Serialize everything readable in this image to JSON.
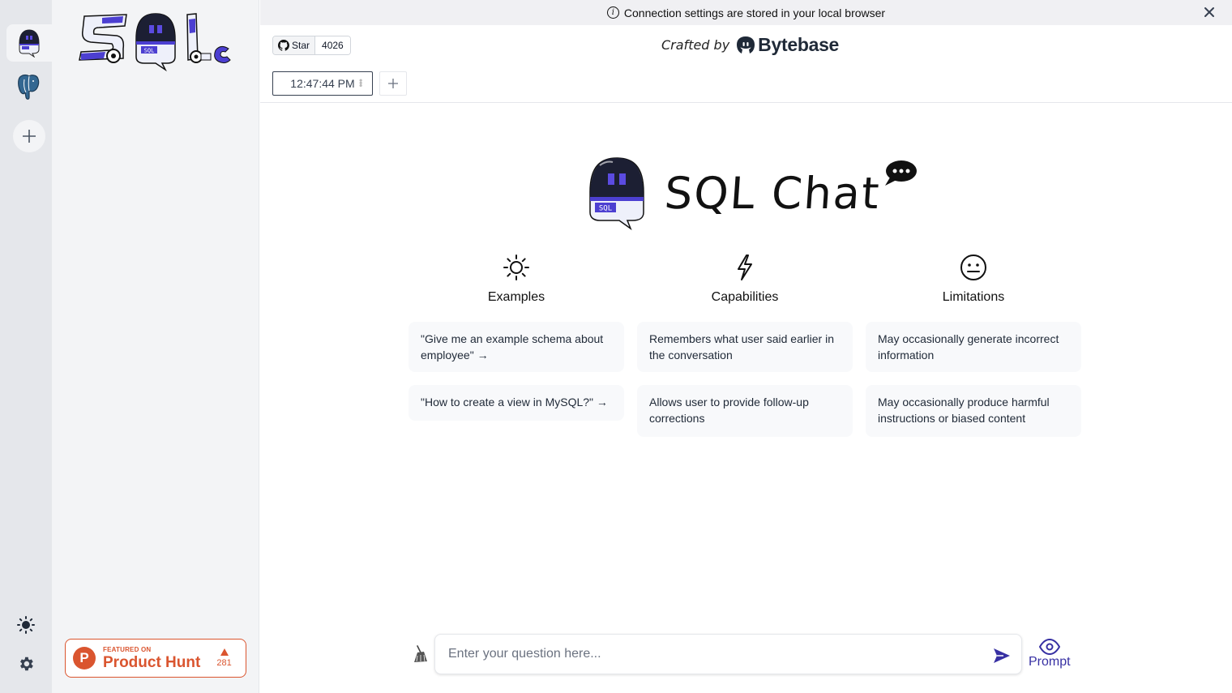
{
  "rail": {
    "items": [
      {
        "name": "sql-chat-connection",
        "active": true
      },
      {
        "name": "postgresql-connection",
        "active": false
      }
    ],
    "add_label": "+",
    "theme_icon": "sun-icon",
    "settings_icon": "gear-icon"
  },
  "sidebar": {
    "logo_text": "SQL Chat logo",
    "product_hunt": {
      "featured_on": "FEATURED ON",
      "name": "Product Hunt",
      "votes": "281",
      "logo_letter": "P"
    }
  },
  "banner": {
    "text": "Connection settings are stored in your local browser",
    "info_icon": "i"
  },
  "header": {
    "github": {
      "star_label": "Star",
      "count": "4026"
    },
    "crafted_by": "Crafted by",
    "brand": "Bytebase"
  },
  "tabs": [
    {
      "label": "12:47:44 PM",
      "active": true
    }
  ],
  "hero": {
    "title": "SQL Chat",
    "logo_badge": "SQL"
  },
  "columns": [
    {
      "icon": "sun-icon",
      "title": "Examples",
      "cards": [
        "\"Give me an example schema about employee\" →",
        "\"How to create a view in MySQL?\" →"
      ]
    },
    {
      "icon": "lightning-icon",
      "title": "Capabilities",
      "cards": [
        "Remembers what user said earlier in the conversation",
        "Allows user to provide follow-up corrections"
      ]
    },
    {
      "icon": "neutral-face-icon",
      "title": "Limitations",
      "cards": [
        "May occasionally generate incorrect information",
        "May occasionally produce harmful instructions or biased content"
      ]
    }
  ],
  "composer": {
    "placeholder": "Enter your question here...",
    "value": "",
    "prompt_label": "Prompt"
  },
  "colors": {
    "accent": "#3730a3",
    "product_hunt": "#da552f",
    "rail_bg": "#e5e7eb",
    "sidebar_bg": "#f3f4f6",
    "card_bg": "#f8f9fb"
  }
}
